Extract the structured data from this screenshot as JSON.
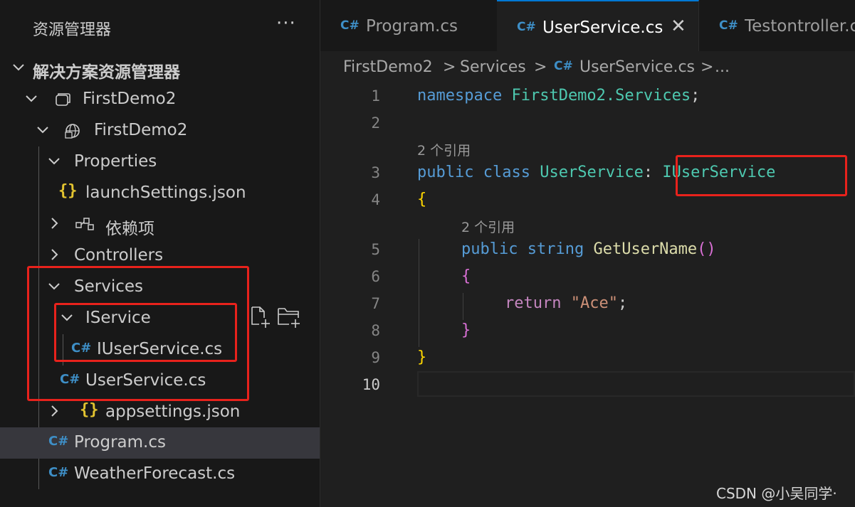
{
  "sidebar": {
    "title": "资源管理器",
    "more": "···",
    "solution_header": "解决方案资源管理器",
    "items": {
      "solution": "FirstDemo2",
      "project": "FirstDemo2",
      "properties": "Properties",
      "launch": "launchSettings.json",
      "deps": "依赖项",
      "controllers": "Controllers",
      "services": "Services",
      "iservice": "IService",
      "iuserservice": "IUserService.cs",
      "userservice": "UserService.cs",
      "appsettings": "appsettings.json",
      "program": "Program.cs",
      "weather": "WeatherForecast.cs"
    },
    "csharp_glyph": "C#",
    "json_glyph": "{}"
  },
  "tabs": [
    {
      "label": "Program.cs",
      "active": false
    },
    {
      "label": "UserService.cs",
      "active": true
    },
    {
      "label": "Testontroller.cs",
      "active": false
    }
  ],
  "tab_close": "✕",
  "breadcrumb": {
    "parts": [
      "FirstDemo2",
      "Services",
      "UserService.cs",
      "..."
    ],
    "sep": ">"
  },
  "editor": {
    "line_numbers": [
      "1",
      "2",
      "3",
      "4",
      "5",
      "6",
      "7",
      "8",
      "9",
      "10"
    ],
    "lens_1": "2 个引用",
    "lens_2": "2 个引用",
    "code": {
      "l1_kw": "namespace",
      "l1_ns": "FirstDemo2.Services",
      "l1_end": ";",
      "l3_kw1": "public",
      "l3_kw2": "class",
      "l3_type": "UserService",
      "l3_colon": ":",
      "l3_iface": "IUserService",
      "l4": "{",
      "l5_kw1": "public",
      "l5_kw2": "string",
      "l5_fn": "GetUserName",
      "l5_paren": "()",
      "l6": "{",
      "l7_kw": "return",
      "l7_str": "\"Ace\"",
      "l7_end": ";",
      "l8": "}",
      "l9": "}"
    }
  },
  "watermark": "CSDN @小吴同学·",
  "colors": {
    "highlight_box": "#e8221c",
    "csharp_icon": "#3e8fc7",
    "json_icon": "#e3c430",
    "active_tab_border": "#0078d4"
  }
}
